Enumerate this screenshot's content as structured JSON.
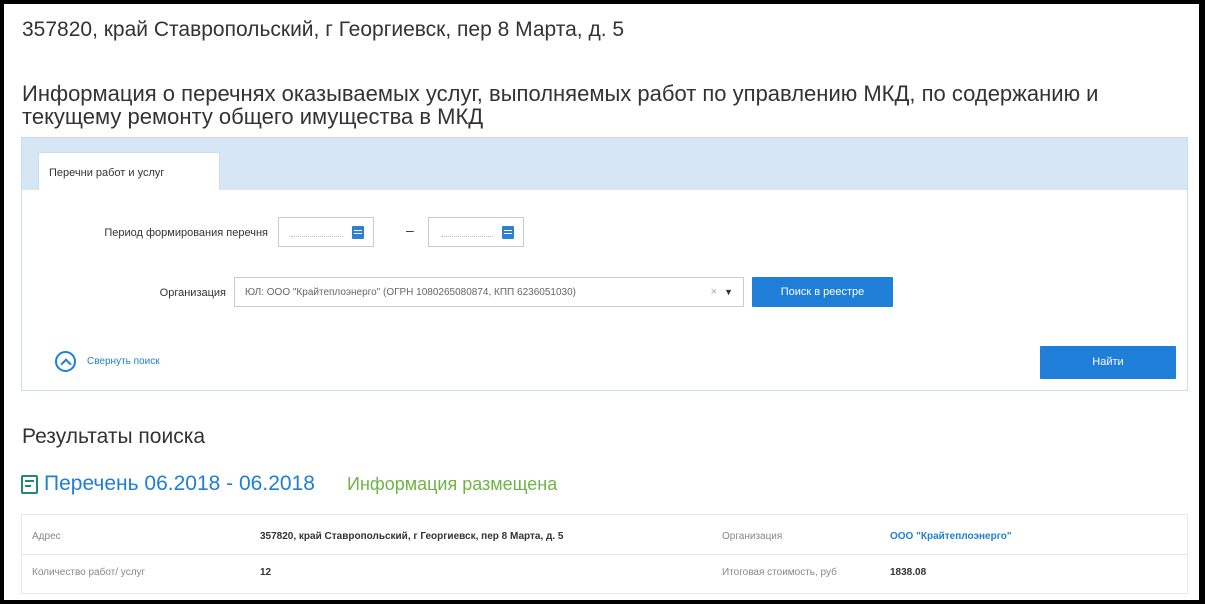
{
  "header": {
    "address": "357820, край Ставропольский, г Георгиевск, пер 8 Марта, д. 5",
    "section_title": "Информация о перечнях оказываемых услуг, выполняемых работ по управлению МКД, по содержанию и текущему ремонту общего имущества в МКД"
  },
  "search": {
    "tab_label": "Перечни работ и услуг",
    "period_label": "Период формирования перечня",
    "date_from_value": "",
    "date_to_value": "",
    "dash": "–",
    "org_label": "Организация",
    "org_value": "ЮЛ: ООО \"Крайтеплоэнерго\" (ОГРН 1080265080874, КПП 6236051030)",
    "clear_glyph": "×",
    "chevron_glyph": "▼",
    "registry_button": "Поиск в реестре",
    "collapse_label": "Свернуть поиск",
    "find_button": "Найти"
  },
  "results": {
    "title": "Результаты поиска",
    "item_title": "Перечень 06.2018 - 06.2018",
    "item_status": "Информация размещена",
    "rows": [
      {
        "label1": "Адрес",
        "value1": "357820, край Ставропольский, г Георгиевск, пер 8 Марта, д. 5",
        "label2": "Организация",
        "value2": "ООО \"Крайтеплоэнерго\""
      },
      {
        "label1": "Количество работ/ услуг",
        "value1": "12",
        "label2": "Итоговая стоимость, руб",
        "value2": "1838.08"
      }
    ]
  },
  "colors": {
    "accent": "#1e7ed8",
    "tab_strip": "#d6e6f4",
    "status_green": "#6fb447"
  }
}
